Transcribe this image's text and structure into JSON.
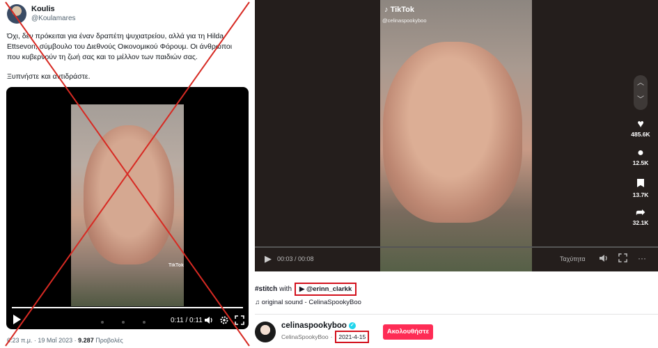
{
  "tweet": {
    "author_name": "Koulis",
    "author_handle": "@Koulamares",
    "text_p1": "Όχι, δεν πρόκειται για έναν δραπέτη ψυχιατρείου, αλλά για τη Hilda Ettsevon, σύμβουλο του Διεθνούς Οικονομικού Φόρουμ. Οι άνθρωποι που κυβερνούν τη ζωή σας και το μέλλον των παιδιών σας.",
    "text_p2": "Ξυπνήστε και αντιδράστε.",
    "video_watermark": "TikTok",
    "video_time": "0:11 / 0:11",
    "meta_time": "6:23 π.μ. · 19 Μαΐ 2023 ·",
    "meta_views": "9.287",
    "meta_views_label": "Προβολές",
    "icons": [
      "play-icon",
      "volume-icon",
      "gear-icon",
      "fullscreen-icon"
    ],
    "cross_color": "#d72a23"
  },
  "tiktok": {
    "watermark_logo": "TikTok",
    "watermark_handle": "@celinaspookyboo",
    "likes": "485.6K",
    "comments": "12.5K",
    "saves": "13.7K",
    "shares": "32.1K",
    "video_time": "00:03 / 00:08",
    "speed_label": "Ταχύτητα",
    "stitch_tag": "#stitch",
    "stitch_with": "with",
    "stitch_user": "@erinn_clarkk",
    "sound": "original sound - CelinaSpookyBoo",
    "username": "celinaspookyboo",
    "display_name": "CelinaSpookyBoo",
    "date": "2021-4-15",
    "follow_label": "Ακολουθήστε",
    "accent_color": "#fe2c55",
    "highlight_color": "#d2101c"
  }
}
